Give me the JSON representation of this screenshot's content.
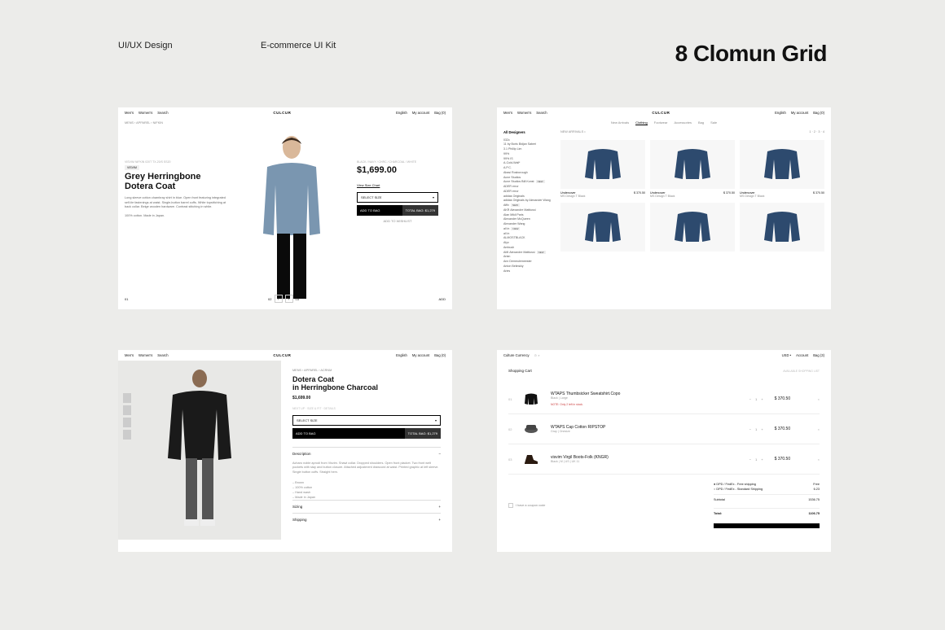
{
  "header": {
    "label_left": "UI/UX Design",
    "label_mid": "E-commerce UI Kit",
    "title": "8 Clomun Grid"
  },
  "nav": {
    "mens": "Men's",
    "womens": "Women's",
    "search": "Search",
    "brand": "CULCUR",
    "english": "English",
    "account": "My account",
    "bag": "Bag (0)"
  },
  "card1": {
    "crumb": "MENS › APPAREL › NIFKIN",
    "meta": "VISVIM NIFKIN 020T TX-20/S SS20",
    "badge": "VISVIM",
    "title1": "Grey Herringbone",
    "title2": "Dotera Coat",
    "desc": "Long sleeve cotton chambray shirt in blue. Open front featuring integrated self-tie fastenings at waist. Single-button barrel cuffs. White topstitching at back collar. Beige wooden hardware. Contrast stitching in white.",
    "origin": "100% cotton. Made in Japan.",
    "right_meta": "BLACK / NAVY / CHRC / CHARCOAL / WHITE",
    "price": "$1,699.00",
    "size_chart": "View Size Chart",
    "select": "SELECT SIZE",
    "add": "ADD TO BAG",
    "total": "TOTAL BAG: $1,279",
    "wish": "ADD TO WISHLIST",
    "page_current": "01",
    "page_mid": "02",
    "page_last": "03",
    "add_label": "ADD"
  },
  "card2": {
    "subnav": [
      "New Arrivals",
      "Clothing",
      "Footwear",
      "Accessories",
      "Bag",
      "Sale"
    ],
    "side_header": "All Designers",
    "designers": [
      "032c",
      "11 by Boris Bidjan Saberi",
      "3.1 Phillip Lim",
      "99%",
      "99% IS",
      "A-Cold-Wall*",
      "A.P.C.",
      "Abasi Rosborough",
      "Acne Studios",
      "Acne Studios Blå Konst",
      "ADER error",
      "ADER error",
      "adidas Originals",
      "adidas Originals by Alexander Wang",
      "Affix",
      "AKR Alexandre Mattiussi",
      "Alan Mikli Paris",
      "Alexander McQueen",
      "Alexander Wang",
      "all in",
      "all in",
      "ALMOSTBLACK",
      "Alyx",
      "Ambush",
      "AMI Alexandre Mattiussi",
      "Arian",
      "Ann Demeulemeester",
      "Anton Belinskiy",
      "Aries"
    ],
    "new_tags": [
      9,
      14,
      19,
      24
    ],
    "bar_left": "NEW ARRIVALS •",
    "bar_right": "1 · 2 · 3 · 4",
    "products": [
      {
        "brand": "Undercover",
        "name": "MS Design T Black",
        "price": "$ 370.50"
      },
      {
        "brand": "Undercover",
        "name": "MS Design T Black",
        "price": "$ 370.50"
      },
      {
        "brand": "Undercover",
        "name": "MS Design T Black",
        "price": "$ 370.50"
      }
    ]
  },
  "card3": {
    "crumb": "MENS › APPAREL › ACRNM",
    "title1": "Dotera Coat",
    "title2": "in Herringbone Charcoal",
    "price": "$1,699.00",
    "meta": "NEXT UP · SIZE & FIT · DETAILS",
    "select": "SELECT SIZE",
    "add": "ADD TO BAG",
    "total": "TOTAL BAG: $1,279",
    "acc_desc": "Description",
    "desc": "Acharo noble aprodi from Visvim. Shawl collar. Dropped shoulders. Open front placket. Two front welt pockets with stay and button closure. Attached adjustment drawcord at waist. Printed graphic at left sleeve. Single button cuffs. Straight hem.",
    "list": [
      "– Brown",
      "– 100% cotton",
      "– Hand wash",
      "– Made in Japan"
    ],
    "acc_sizing": "Sizing",
    "acc_shipping": "Shipping"
  },
  "card4": {
    "nav_left": "Culture Currency",
    "nav_usd": "USD •",
    "nav_account": "Account",
    "nav_bag": "Bag (3)",
    "header": "Shopping Cart",
    "sublabel": "AVAILABLE SHOPPING LIST",
    "items": [
      {
        "idx": "01",
        "name": "WTAPS Thumbsicker Sweatshirt.Copo",
        "sub": "Black | Large",
        "note": "NOTE: Only 2 left in stock.",
        "price": "$ 370.50"
      },
      {
        "idx": "02",
        "name": "WTAPS Cap Cotton RIPSTOP",
        "sub": "Gray | Onesize",
        "note": "",
        "price": "$ 370.50"
      },
      {
        "idx": "03",
        "name": "visvim Virgil Boots-Folk (KNGR)",
        "sub": "Black | M | US | UK 11",
        "note": "",
        "price": "$ 370.50"
      }
    ],
    "qty": "1",
    "coupon": "I have a coupon code",
    "ship1_label": "● DPD / FedEx - Free shipping",
    "ship1_val": "Free",
    "ship2_label": "○ DPD / FedEx - Standard Shipping",
    "ship2_val": "6.23",
    "subtotal_label": "Subtotal",
    "subtotal_val": "1536.75",
    "total_label": "Total:",
    "total_val": "1106.75"
  }
}
